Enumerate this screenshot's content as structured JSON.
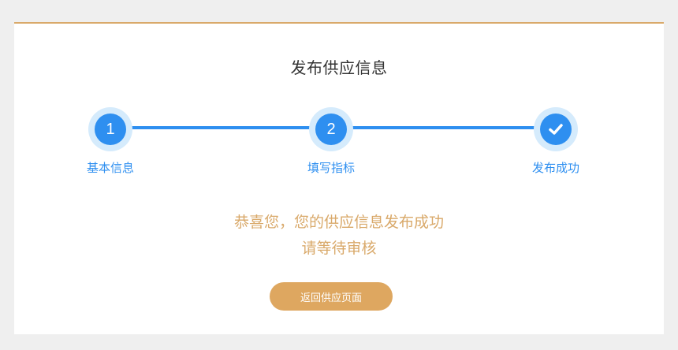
{
  "page": {
    "title": "发布供应信息"
  },
  "steps": [
    {
      "number": "1",
      "label": "基本信息"
    },
    {
      "number": "2",
      "label": "填写指标"
    },
    {
      "number": "",
      "label": "发布成功",
      "icon": "check-icon"
    }
  ],
  "message": {
    "line1": "恭喜您，您的供应信息发布成功",
    "line2": "请等待审核"
  },
  "button": {
    "label": "返回供应页面"
  },
  "colors": {
    "accent": "#d9a96a",
    "primary": "#2e8ff0",
    "step_halo": "#d5ebfc",
    "button": "#dea760"
  }
}
